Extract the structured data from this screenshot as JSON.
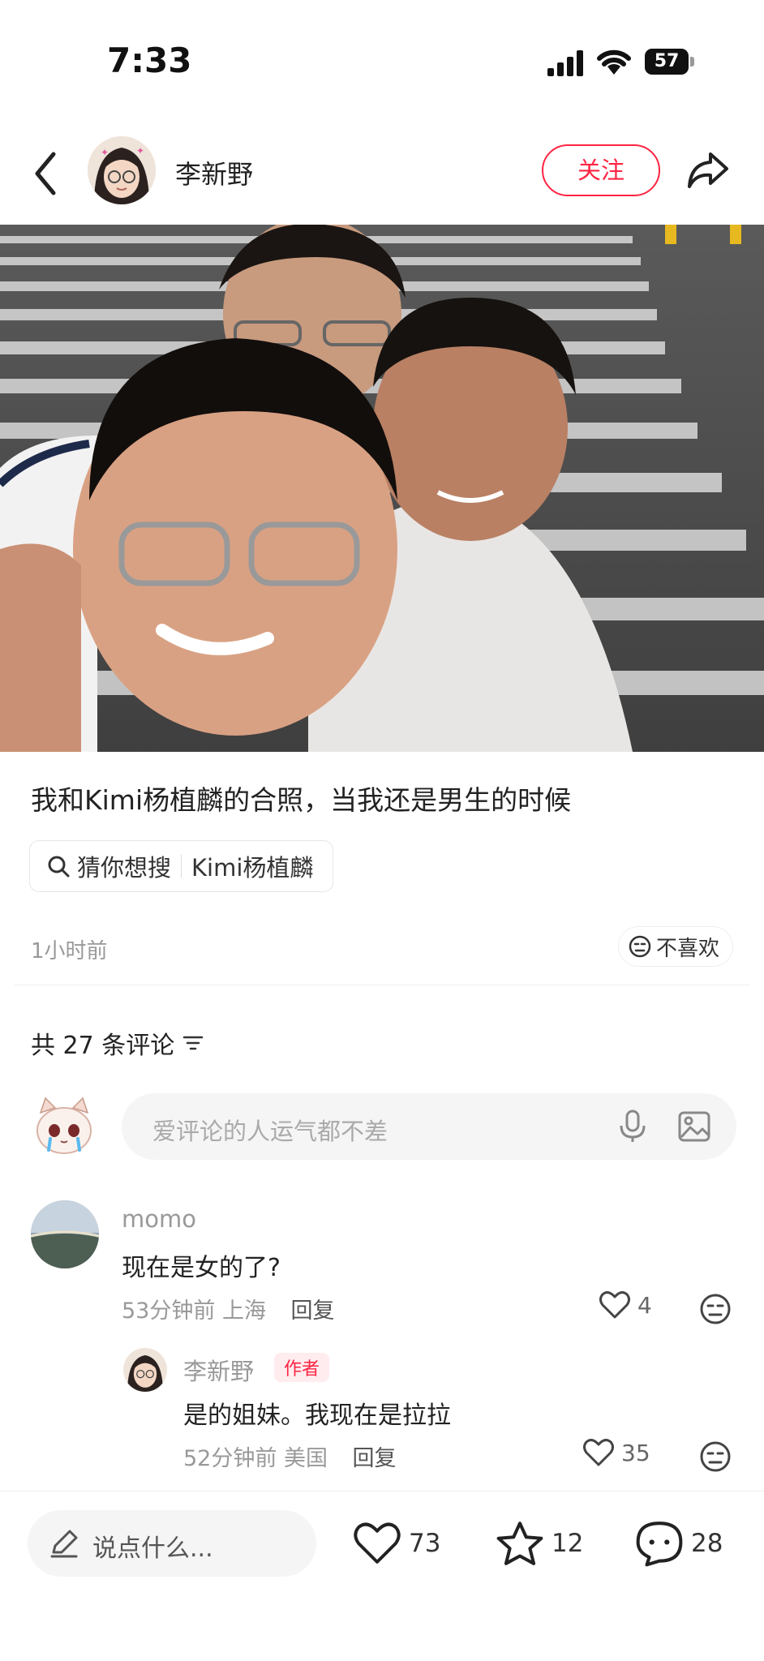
{
  "status_bar": {
    "time": "7:33",
    "battery": "57"
  },
  "header": {
    "author_name": "李新野",
    "follow_label": "关注"
  },
  "post": {
    "title": "我和Kimi杨植麟的合照，当我还是男生的时候",
    "search_prefix": "猜你想搜",
    "search_term": "Kimi杨植麟",
    "time": "1小时前",
    "dislike_label": "不喜欢"
  },
  "comments": {
    "count_label": "共 27 条评论",
    "input_placeholder": "爱评论的人运气都不差",
    "items": [
      {
        "name": "momo",
        "text": "现在是女的了?",
        "time": "53分钟前",
        "location": "上海",
        "reply_label": "回复",
        "likes": "4"
      },
      {
        "name": "李新野",
        "tag": "作者",
        "text": "是的姐妹。我现在是拉拉",
        "time": "52分钟前",
        "location": "美国",
        "reply_label": "回复",
        "likes": "35"
      }
    ]
  },
  "bottom_bar": {
    "input_placeholder": "说点什么...",
    "likes": "73",
    "stars": "12",
    "comments": "28"
  },
  "colors": {
    "accent": "#ff2442",
    "muted": "#999999",
    "input_bg": "#f5f5f5"
  },
  "icons": [
    "back-icon",
    "share-icon",
    "search-icon",
    "dislike-face-icon",
    "sort-icon",
    "microphone-icon",
    "image-icon",
    "heart-icon",
    "pencil-icon",
    "star-icon",
    "comment-bubble-icon"
  ]
}
